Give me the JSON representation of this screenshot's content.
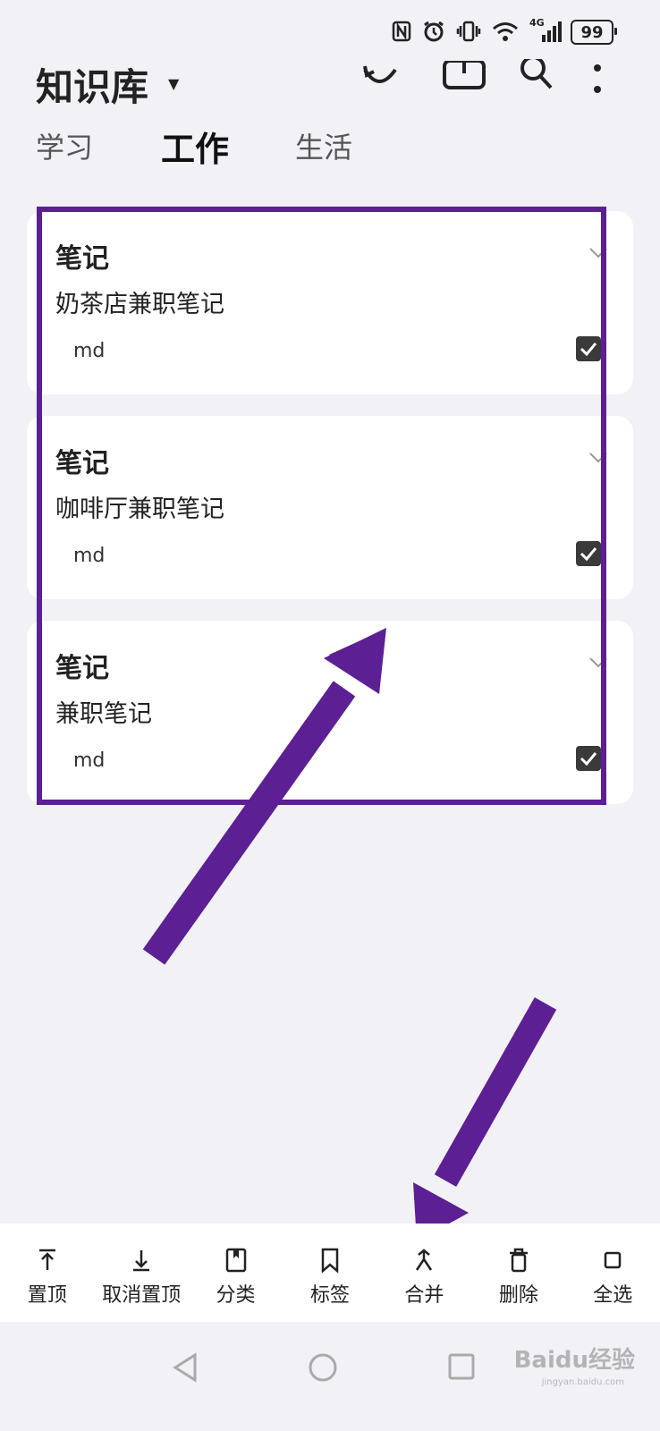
{
  "status_bar": {
    "battery": "99",
    "icons": [
      "nfc-icon",
      "alarm-icon",
      "vibrate-icon",
      "wifi-icon",
      "signal-4g-icon"
    ],
    "network_label": "4G"
  },
  "app_bar": {
    "title": "知识库",
    "icons": [
      "sync-icon",
      "import-icon",
      "search-icon",
      "more-icon"
    ]
  },
  "tabs": [
    {
      "label": "学习",
      "active": false
    },
    {
      "label": "工作",
      "active": true
    },
    {
      "label": "生活",
      "active": false
    }
  ],
  "notes": [
    {
      "type": "笔记",
      "title": "奶茶店兼职笔记",
      "ext": "md",
      "checked": true
    },
    {
      "type": "笔记",
      "title": "咖啡厅兼职笔记",
      "ext": "md",
      "checked": true
    },
    {
      "type": "笔记",
      "title": "兼职笔记",
      "ext": "md",
      "checked": true
    }
  ],
  "toolbar": [
    {
      "label": "置顶",
      "icon": "pin-top-icon"
    },
    {
      "label": "取消置顶",
      "icon": "unpin-icon"
    },
    {
      "label": "分类",
      "icon": "category-icon"
    },
    {
      "label": "标签",
      "icon": "bookmark-icon"
    },
    {
      "label": "合并",
      "icon": "merge-icon"
    },
    {
      "label": "删除",
      "icon": "delete-icon"
    },
    {
      "label": "全选",
      "icon": "select-all-icon"
    }
  ],
  "watermark": {
    "text": "Baidu经验",
    "sub": "jingyan.baidu.com"
  },
  "colors": {
    "annotation": "#5c1f94",
    "background": "#f2f1f6",
    "checkbox": "#3a3a3a"
  }
}
